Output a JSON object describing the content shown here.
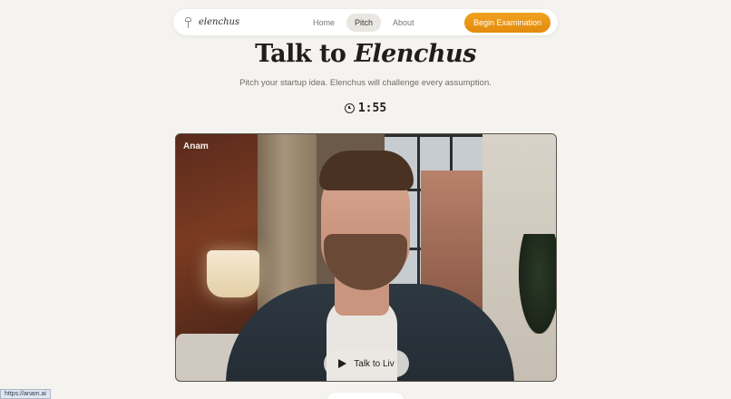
{
  "nav": {
    "brand": "elenchus",
    "links": [
      {
        "label": "Home"
      },
      {
        "label": "Pitch"
      },
      {
        "label": "About"
      }
    ],
    "cta_label": "Begin Examination"
  },
  "hero": {
    "title_prefix": "Talk to ",
    "title_emphasis": "Elenchus",
    "subtitle": "Pitch your startup idea. Elenchus will challenge every assumption."
  },
  "timer": {
    "value": "1:55",
    "icon": "clock-icon"
  },
  "video": {
    "label": "Anam",
    "talk_button_label": "Talk to Liv"
  },
  "status_bar": {
    "url": "https://anam.ai"
  },
  "colors": {
    "accent": "#e9920f",
    "background": "#f4f3ef"
  }
}
